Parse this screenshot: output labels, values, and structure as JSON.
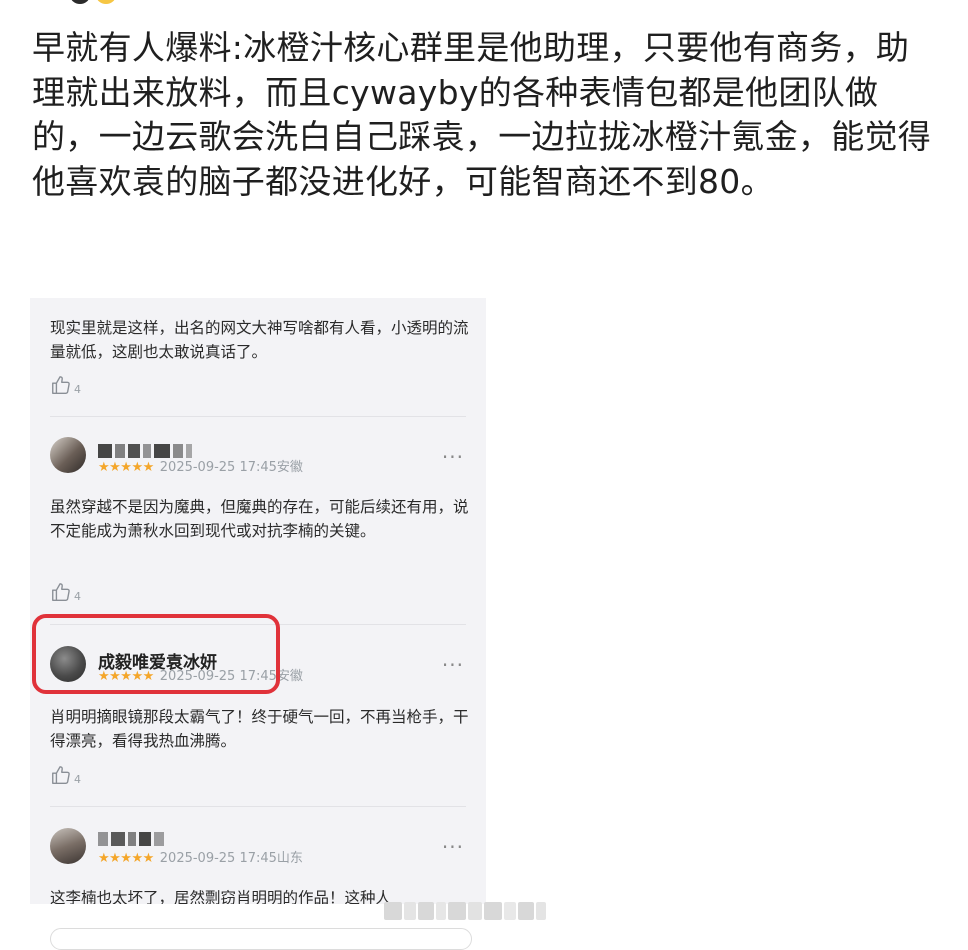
{
  "post": {
    "text": "早就有人爆料:冰橙汁核心群里是他助理，只要他有商务，助理就出来放料，而且cywayby的各种表情包都是他团队做的，一边云歌会洗白自己踩袁，一边拉拢冰橙汁氪金，能觉得他喜欢袁的脑子都没进化好，可能智商还不到80。"
  },
  "screenshot": {
    "comments": [
      {
        "text": "现实里就是这样，出名的网文大神写啥都有人看，小透明的流量就低，这剧也太敢说真话了。",
        "likes": "4"
      },
      {
        "user": "",
        "stars": "★★★★★",
        "meta": "2025-09-25 17:45安徽",
        "more": "···",
        "text": "虽然穿越不是因为魔典，但魔典的存在，可能后续还有用，说不定能成为萧秋水回到现代或对抗李楠的关键。",
        "likes": "4"
      },
      {
        "user": "成毅唯爱袁冰妍",
        "stars": "★★★★★",
        "meta": "2025-09-25 17:45安徽",
        "more": "···",
        "text": "肖明明摘眼镜那段太霸气了！终于硬气一回，不再当枪手，干得漂亮，看得我热血沸腾。",
        "likes": "4"
      },
      {
        "user": "",
        "stars": "★★★★★",
        "meta": "2025-09-25 17:45山东",
        "more": "···",
        "text": "这李楠也太坏了，居然剽窃肖明明的作品！这种人"
      }
    ]
  },
  "colors": {
    "highlight": "#e0323a",
    "star": "#f4a62a",
    "meta": "#9aa0a6"
  }
}
